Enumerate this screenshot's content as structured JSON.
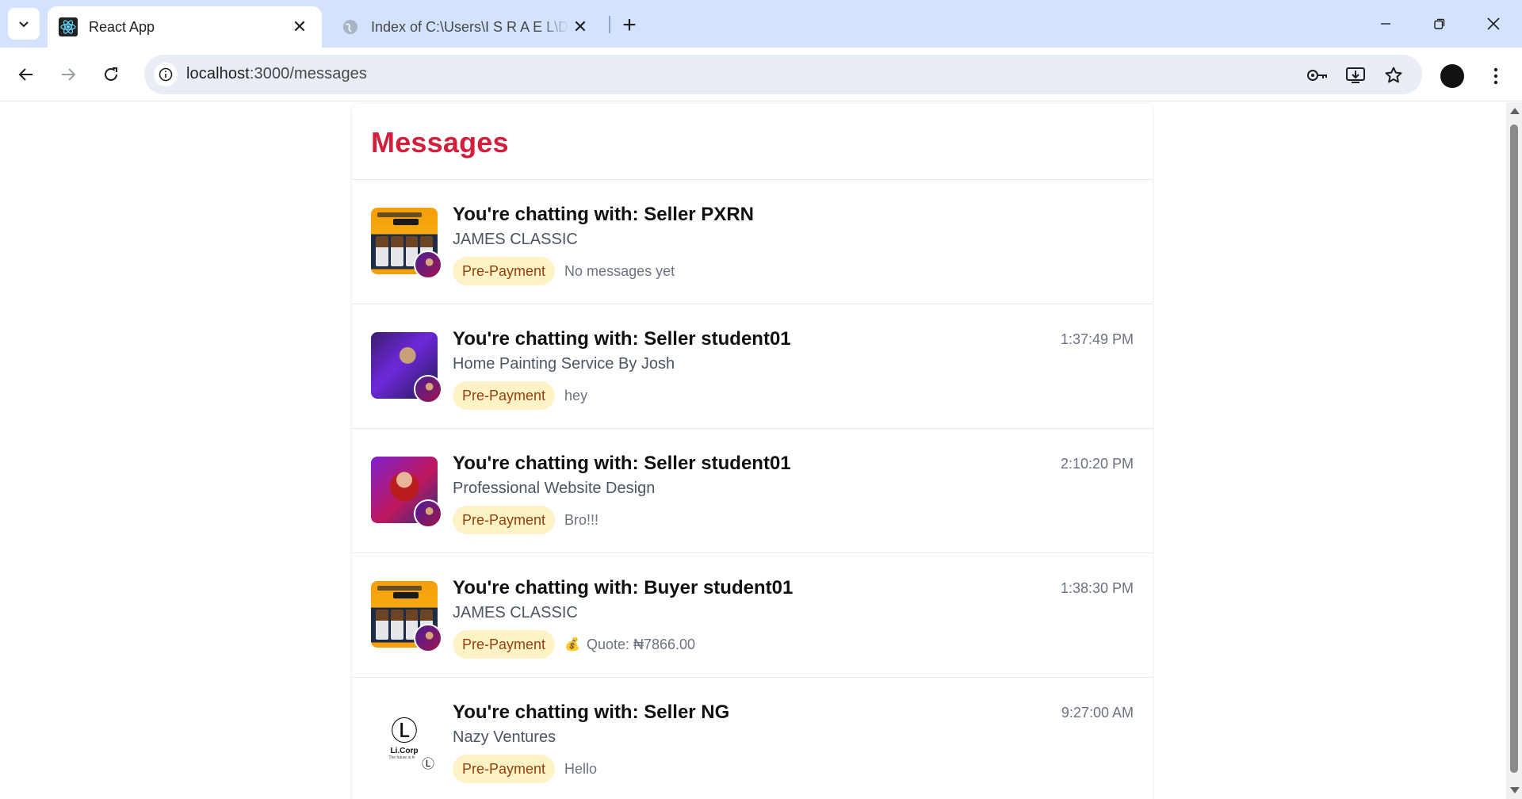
{
  "browser": {
    "tabs": [
      {
        "title": "React App",
        "active": true,
        "favicon": "react-icon"
      },
      {
        "title": "Index of C:\\Users\\I S R A E L\\De",
        "active": false,
        "favicon": "globe-icon"
      }
    ],
    "url": {
      "host": "localhost",
      "path": ":3000/messages"
    }
  },
  "page": {
    "title": "Messages",
    "conversations": [
      {
        "title": "You're chatting with: Seller PXRN",
        "subtitle": "JAMES CLASSIC",
        "badge": "Pre-Payment",
        "preview": "No messages yet",
        "time": "",
        "thumb": "poster",
        "has_quote_icon": false
      },
      {
        "title": "You're chatting with: Seller student01",
        "subtitle": "Home Painting Service By Josh",
        "badge": "Pre-Payment",
        "preview": "hey",
        "time": "1:37:49 PM",
        "thumb": "hero-a",
        "has_quote_icon": false
      },
      {
        "title": "You're chatting with: Seller student01",
        "subtitle": "Professional Website Design",
        "badge": "Pre-Payment",
        "preview": "Bro!!!",
        "time": "2:10:20 PM",
        "thumb": "hero-b",
        "has_quote_icon": false
      },
      {
        "title": "You're chatting with: Buyer student01",
        "subtitle": "JAMES CLASSIC",
        "badge": "Pre-Payment",
        "preview": "Quote: ₦7866.00",
        "time": "1:38:30 PM",
        "thumb": "poster",
        "has_quote_icon": true
      },
      {
        "title": "You're chatting with: Seller NG",
        "subtitle": "Nazy Ventures",
        "badge": "Pre-Payment",
        "preview": "Hello",
        "time": "9:27:00 AM",
        "thumb": "logo",
        "has_quote_icon": false
      }
    ],
    "logo": {
      "mark": "LC",
      "name": "Li.Corp",
      "tagline": "The future is here"
    },
    "quote_icon": "money-bag-icon"
  },
  "colors": {
    "title": "#d11f3c",
    "badge_bg": "#fef3c7",
    "badge_text": "#92400e",
    "chrome_bg": "#d3e3fd"
  }
}
